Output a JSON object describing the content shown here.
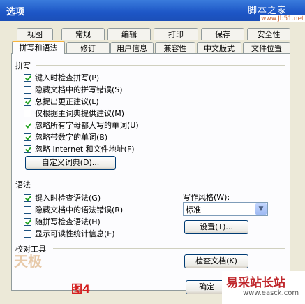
{
  "window": {
    "title": "选项",
    "watermark_top": "脚本之家",
    "watermark_url": "www.Jb51.net"
  },
  "tabs_row1": [
    "视图",
    "常规",
    "编辑",
    "打印",
    "保存",
    "安全性"
  ],
  "tabs_row2": [
    "拼写和语法",
    "修订",
    "用户信息",
    "兼容性",
    "中文版式",
    "文件位置"
  ],
  "spelling": {
    "title": "拼写",
    "options": [
      {
        "label": "键入时检查拼写(P)",
        "checked": true
      },
      {
        "label": "隐藏文档中的拼写错误(S)",
        "checked": false
      },
      {
        "label": "总提出更正建议(L)",
        "checked": true
      },
      {
        "label": "仅根据主词典提供建议(M)",
        "checked": false
      },
      {
        "label": "忽略所有字母都大写的单词(U)",
        "checked": true
      },
      {
        "label": "忽略带数字的单词(B)",
        "checked": true
      },
      {
        "label": "忽略 Internet 和文件地址(F)",
        "checked": true
      }
    ],
    "custom_dict_button": "自定义词典(D)..."
  },
  "grammar": {
    "title": "语法",
    "options": [
      {
        "label": "键入时检查语法(G)",
        "checked": true
      },
      {
        "label": "隐藏文档中的语法错误(R)",
        "checked": false
      },
      {
        "label": "随拼写检查语法(H)",
        "checked": true
      },
      {
        "label": "显示可读性统计信息(E)",
        "checked": false
      }
    ],
    "style_label": "写作风格(W):",
    "style_value": "标准",
    "settings_button": "设置(T)..."
  },
  "proofing": {
    "title": "校对工具",
    "check_button": "检查文档(K)"
  },
  "ok_button": "确定",
  "figure_caption": "图4",
  "logo_left": "天极",
  "logo_right_title": "易采站长站",
  "logo_right_url": "www.easck.com",
  "colors": {
    "titlebar": "#1d56c6",
    "active_tab_accent": "#f9b43a",
    "check": "#21a121"
  }
}
